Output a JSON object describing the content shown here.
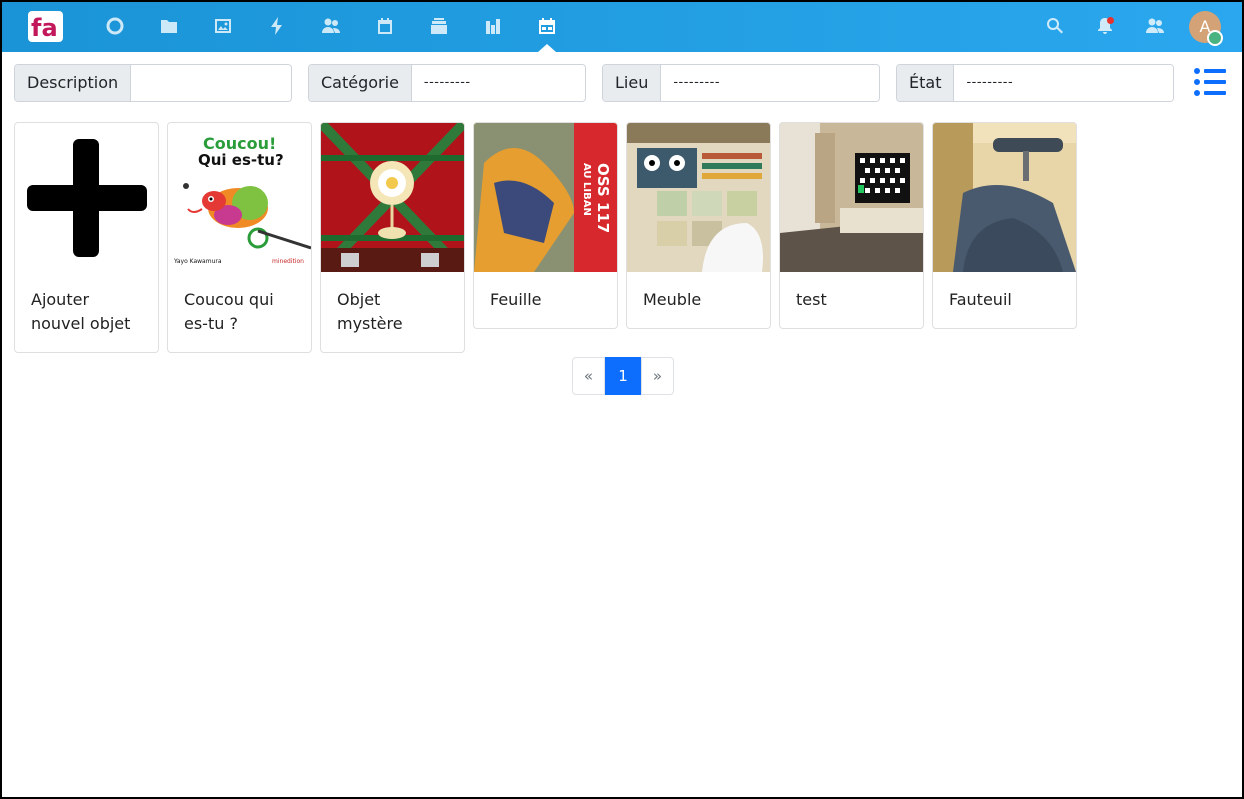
{
  "header": {
    "logo_text": "fa",
    "nav": [
      {
        "name": "dashboard-icon"
      },
      {
        "name": "files-icon"
      },
      {
        "name": "photos-icon"
      },
      {
        "name": "activity-icon"
      },
      {
        "name": "contacts-icon"
      },
      {
        "name": "calendar-icon"
      },
      {
        "name": "deck-icon"
      },
      {
        "name": "analytics-icon"
      },
      {
        "name": "inventory-icon",
        "active": true
      }
    ],
    "search_icon": "search-icon",
    "notifications_icon": "bell-icon",
    "contacts_menu_icon": "contacts-menu-icon",
    "avatar_initial": "A",
    "accent": "#1a94d6"
  },
  "filters": [
    {
      "label": "Description",
      "value": ""
    },
    {
      "label": "Catégorie",
      "value": "---------"
    },
    {
      "label": "Lieu",
      "value": "---------"
    },
    {
      "label": "État",
      "value": "---------"
    }
  ],
  "cards": [
    {
      "title": "Ajouter nouvel objet",
      "image": "plus"
    },
    {
      "title": "Coucou qui es-tu ?",
      "image": "book",
      "cover_title_1": "Coucou!",
      "cover_title_2": "Qui es-tu?",
      "cover_author": "Yayo Kawamura",
      "cover_publisher": "minedition"
    },
    {
      "title": "Objet mystère",
      "image": "ceiling"
    },
    {
      "title": "Feuille",
      "image": "poster",
      "poster_text_1": "OSS 117",
      "poster_text_2": "AU LIBAN"
    },
    {
      "title": "Meuble",
      "image": "shelf"
    },
    {
      "title": "test",
      "image": "room"
    },
    {
      "title": "Fauteuil",
      "image": "chair"
    }
  ],
  "pagination": {
    "prev": "«",
    "current": "1",
    "next": "»"
  }
}
